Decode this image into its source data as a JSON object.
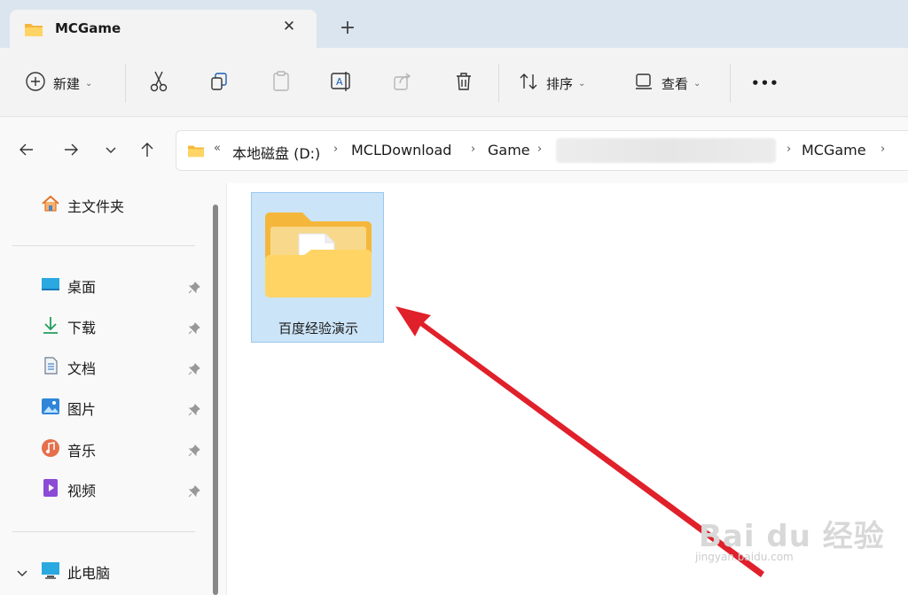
{
  "tab": {
    "title": "MCGame",
    "close": "✕",
    "new_tab": "+"
  },
  "toolbar": {
    "new_label": "新建",
    "sort_label": "排序",
    "view_label": "查看",
    "more": "•••"
  },
  "addressbar": {
    "overflow": "«",
    "crumbs": [
      "本地磁盘 (D:)",
      "MCLDownload",
      "Game",
      "MCGame"
    ],
    "sep": "›"
  },
  "sidebar": {
    "home": "主文件夹",
    "quick": [
      "桌面",
      "下载",
      "文档",
      "图片",
      "音乐",
      "视频"
    ],
    "this_pc": "此电脑"
  },
  "content": {
    "folders": [
      {
        "name": "百度经验演示"
      }
    ]
  },
  "watermark": {
    "big": "Bai du 经验",
    "small": "jingyan.baidu.com"
  },
  "colors": {
    "accent": "#0067c0",
    "selection": "#cce4f7",
    "arrow": "#e0202a",
    "folder": "#f7c244"
  }
}
